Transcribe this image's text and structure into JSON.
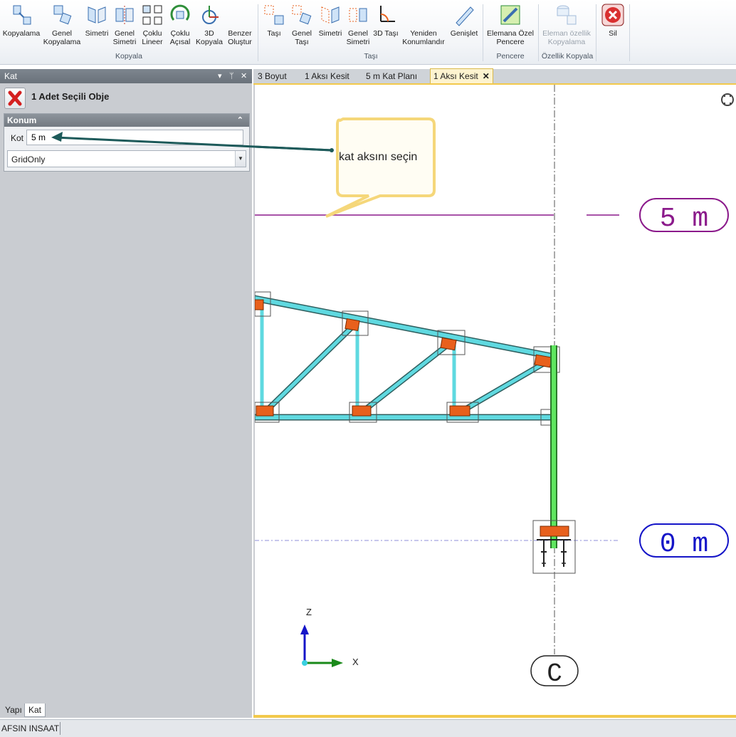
{
  "ribbon": {
    "kopyala_group": {
      "label": "Kopyala",
      "buttons": [
        "Kopyalama",
        "Genel Kopyalama",
        "Simetri",
        "Genel Simetri",
        "Çoklu Lineer",
        "Çoklu Açısal",
        "3D Kopyala",
        "Benzer Oluştur"
      ]
    },
    "tasi_group": {
      "label": "Taşı",
      "buttons": [
        "Taşı",
        "Genel Taşı",
        "Simetri",
        "Genel Simetri",
        "3D Taşı",
        "Yeniden Konumlandır",
        "Genişlet"
      ]
    },
    "pencere_group": {
      "label": "Pencere",
      "buttons": [
        "Elemana Özel Pencere"
      ]
    },
    "ozellik_group": {
      "label": "Özellik Kopyala",
      "buttons": [
        "Eleman özellik Kopyalama"
      ]
    },
    "sil_group": {
      "buttons": [
        "Sil"
      ]
    }
  },
  "panel": {
    "title": "Kat",
    "pin_icon": "pin-icon",
    "close_icon": "close-icon",
    "selection_title": "1 Adet Seçili Obje",
    "konum": {
      "header": "Konum",
      "kot_label": "Kot",
      "kot_value": "5 m",
      "grid_value": "GridOnly"
    },
    "bottom_tabs": [
      "Yapı",
      "Kat"
    ],
    "active_bottom_tab": "Kat"
  },
  "doc_tabs": [
    "3 Boyut",
    "1 Aksı Kesit",
    "5 m Kat Planı",
    "1 Aksı Kesit"
  ],
  "active_doc_tab": "1 Aksı Kesit",
  "viewport": {
    "callout_text": "kat aksını seçin",
    "level_labels": [
      "5 m",
      "0 m"
    ],
    "axis_label": "C",
    "axes": {
      "z": "Z",
      "x": "X"
    },
    "colors": {
      "level_5m": "#8b1a8b",
      "level_0m": "#1515c8",
      "truss": "#5fd9e0",
      "column": "#5fe65f",
      "plate": "#e8601c"
    }
  },
  "status": {
    "company": "AFSIN INSAAT"
  }
}
